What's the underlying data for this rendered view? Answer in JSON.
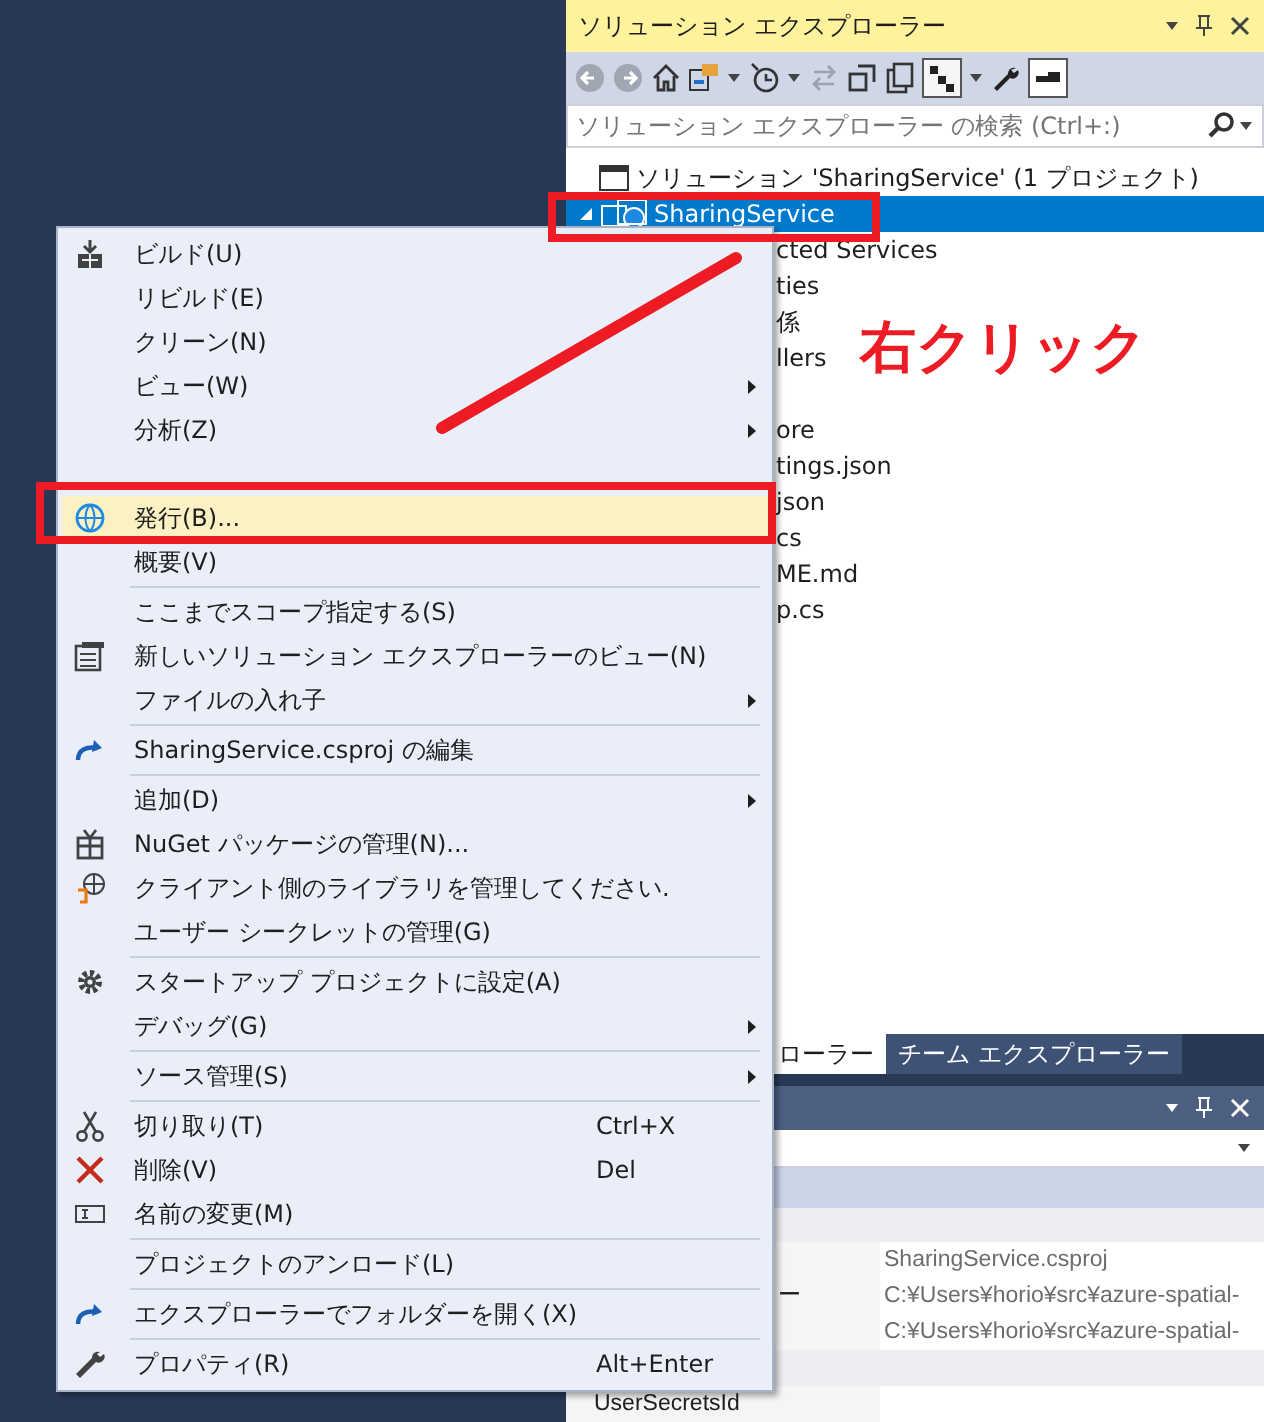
{
  "solution_explorer": {
    "title": "ソリューション エクスプローラー",
    "search": {
      "placeholder": "ソリューション エクスプローラー の検索 (Ctrl+:)"
    },
    "tree": [
      {
        "text": "ソリューション 'SharingService' (1 プロジェクト)",
        "selected": false,
        "children": [
          {
            "text": "SharingService",
            "selected": true,
            "expanded": true,
            "children": [
              {
                "text": "cted Services",
                "selected": false
              },
              {
                "text": "ties",
                "selected": false
              },
              {
                "text": "係",
                "selected": false
              },
              {
                "text": "llers",
                "selected": false
              },
              {
                "text": "ore",
                "selected": false
              },
              {
                "text": "tings.json",
                "selected": false
              },
              {
                "text": "json",
                "selected": false
              },
              {
                "text": "cs",
                "selected": false
              },
              {
                "text": "ME.md",
                "selected": false
              },
              {
                "text": "p.cs",
                "selected": false
              }
            ]
          }
        ]
      }
    ],
    "tabs": [
      {
        "label": "ローラー",
        "selected": true
      },
      {
        "label": "チーム エクスプローラー",
        "selected": false
      }
    ]
  },
  "properties": {
    "rows": [
      {
        "value": "SharingService.csproj"
      },
      {
        "name": "ー",
        "value": "C:¥Users¥horio¥src¥azure-spatial-"
      },
      {
        "value": "C:¥Users¥horio¥src¥azure-spatial-"
      },
      {
        "name": "UserSecretsId"
      }
    ]
  },
  "context_menu": {
    "items": [
      {
        "kind": "item",
        "label": "ビルド(U)",
        "selected": false
      },
      {
        "kind": "item",
        "label": "リビルド(E)",
        "selected": false
      },
      {
        "kind": "item",
        "label": "クリーン(N)",
        "selected": false
      },
      {
        "kind": "item",
        "label": "ビュー(W)",
        "submenu": true,
        "selected": false
      },
      {
        "kind": "item",
        "label": "分析(Z)",
        "submenu": true,
        "selected": false
      },
      {
        "kind": "hidden"
      },
      {
        "kind": "item",
        "label": "発行(B)...",
        "selected": true
      },
      {
        "kind": "item",
        "label": "概要(V)",
        "selected": false
      },
      {
        "kind": "separator"
      },
      {
        "kind": "item",
        "label": "ここまでスコープ指定する(S)",
        "selected": false
      },
      {
        "kind": "item",
        "label": "新しいソリューション エクスプローラーのビュー(N)",
        "selected": false
      },
      {
        "kind": "item",
        "label": "ファイルの入れ子",
        "submenu": true,
        "selected": false
      },
      {
        "kind": "separator"
      },
      {
        "kind": "item",
        "label": "SharingService.csproj の編集",
        "selected": false
      },
      {
        "kind": "separator"
      },
      {
        "kind": "item",
        "label": "追加(D)",
        "submenu": true,
        "selected": false
      },
      {
        "kind": "item",
        "label": "NuGet パッケージの管理(N)...",
        "selected": false
      },
      {
        "kind": "item",
        "label": "クライアント側のライブラリを管理してください.",
        "selected": false
      },
      {
        "kind": "item",
        "label": "ユーザー シークレットの管理(G)",
        "selected": false
      },
      {
        "kind": "separator"
      },
      {
        "kind": "item",
        "label": "スタートアップ プロジェクトに設定(A)",
        "selected": false
      },
      {
        "kind": "item",
        "label": "デバッグ(G)",
        "submenu": true,
        "selected": false
      },
      {
        "kind": "separator"
      },
      {
        "kind": "item",
        "label": "ソース管理(S)",
        "submenu": true,
        "selected": false
      },
      {
        "kind": "separator"
      },
      {
        "kind": "item",
        "label": "切り取り(T)",
        "shortcut": "Ctrl+X",
        "selected": false
      },
      {
        "kind": "item",
        "label": "削除(V)",
        "shortcut": "Del",
        "selected": false
      },
      {
        "kind": "item",
        "label": "名前の変更(M)",
        "selected": false
      },
      {
        "kind": "separator"
      },
      {
        "kind": "item",
        "label": "プロジェクトのアンロード(L)",
        "selected": false
      },
      {
        "kind": "separator"
      },
      {
        "kind": "item",
        "label": "エクスプローラーでフォルダーを開く(X)",
        "selected": false
      },
      {
        "kind": "separator"
      },
      {
        "kind": "item",
        "label": "プロパティ(R)",
        "shortcut": "Alt+Enter",
        "selected": false
      }
    ]
  },
  "annotation": {
    "label": "右クリック"
  }
}
